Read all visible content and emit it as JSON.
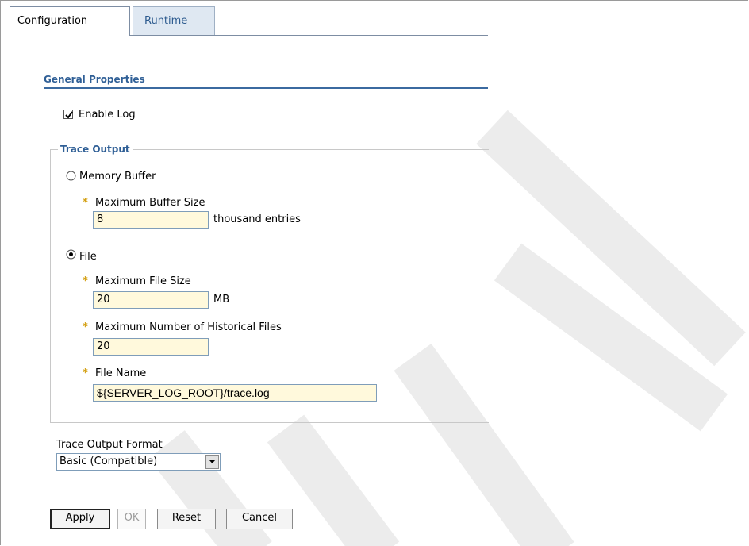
{
  "tabs": [
    {
      "label": "Configuration",
      "active": true
    },
    {
      "label": "Runtime",
      "active": false
    }
  ],
  "general": {
    "title": "General Properties",
    "enable_log_label": "Enable Log",
    "enable_log_checked": true
  },
  "trace_output": {
    "legend": "Trace Output",
    "memory_buffer_label": "Memory Buffer",
    "memory_buffer_selected": false,
    "max_buffer_label": "Maximum Buffer Size",
    "max_buffer_value": "8",
    "max_buffer_unit": "thousand entries",
    "file_label": "File",
    "file_selected": true,
    "max_file_size_label": "Maximum File Size",
    "max_file_size_value": "20",
    "max_file_size_unit": "MB",
    "max_hist_label": "Maximum Number of Historical Files",
    "max_hist_value": "20",
    "file_name_label": "File Name",
    "file_name_value": "${SERVER_LOG_ROOT}/trace.log",
    "required_marker": "*"
  },
  "format": {
    "label": "Trace Output Format",
    "selected": "Basic (Compatible)"
  },
  "buttons": {
    "apply": "Apply",
    "ok": "OK",
    "reset": "Reset",
    "cancel": "Cancel"
  },
  "colors": {
    "accent": "#2f5f96",
    "input_bg": "#fff9dc",
    "required": "#d4a012"
  }
}
